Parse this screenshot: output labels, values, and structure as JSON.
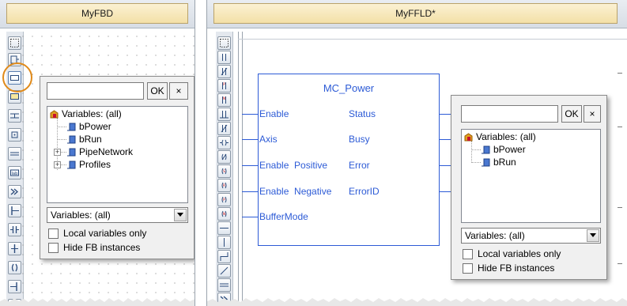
{
  "left_panel": {
    "tab_title": "MyFBD",
    "popup": {
      "search_value": "",
      "ok_label": "OK",
      "close_label": "×",
      "tree": [
        {
          "label": "Variables: (all)",
          "icon": "variables-root-icon"
        },
        {
          "label": "bPower",
          "icon": "variable-icon"
        },
        {
          "label": "bRun",
          "icon": "variable-icon"
        },
        {
          "label": "PipeNetwork",
          "icon": "variable-icon",
          "expander": "+"
        },
        {
          "label": "Profiles",
          "icon": "variable-icon",
          "expander": "+"
        }
      ],
      "filter_selected": "Variables: (all)",
      "checkbox_local": "Local variables only",
      "checkbox_hide_fb": "Hide FB instances"
    }
  },
  "right_panel": {
    "tab_title": "MyFFLD*",
    "function_block": {
      "name": "MC_Power",
      "inputs": [
        "Enable",
        "Axis",
        "Enable  Positive",
        "Enable  Negative",
        "BufferMode"
      ],
      "outputs": [
        "Status",
        "Busy",
        "Error",
        "ErrorID"
      ]
    },
    "popup": {
      "search_value": "",
      "ok_label": "OK",
      "close_label": "×",
      "tree": [
        {
          "label": "Variables: (all)",
          "icon": "variables-root-icon"
        },
        {
          "label": "bPower",
          "icon": "variable-icon"
        },
        {
          "label": "bRun",
          "icon": "variable-icon"
        }
      ],
      "filter_selected": "Variables: (all)",
      "checkbox_local": "Local variables only",
      "checkbox_hide_fb": "Hide FB instances"
    }
  },
  "colors": {
    "tab_gold": "#f3e0a7",
    "fb_blue": "#2d5bd6",
    "highlight_orange": "#e08a1a"
  }
}
